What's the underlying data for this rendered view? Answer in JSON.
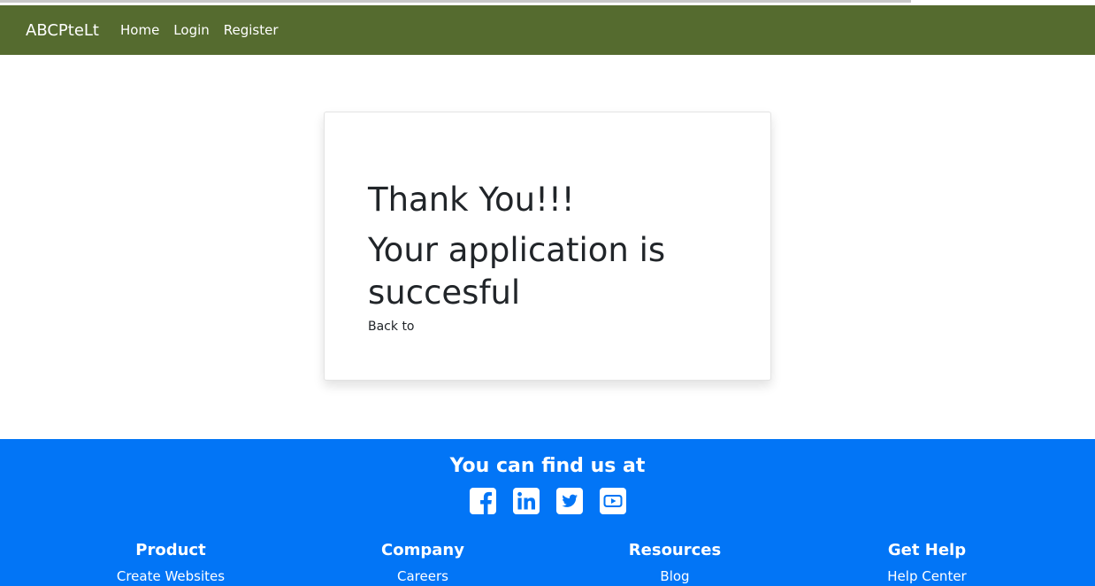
{
  "nav": {
    "brand": "ABCPteLt",
    "links": [
      "Home",
      "Login",
      "Register"
    ]
  },
  "card": {
    "title": "Thank You!!!",
    "message": "Your application is succesful",
    "back_text": "Back to"
  },
  "footer": {
    "heading": "You can find us at",
    "social_icons": [
      "facebook-icon",
      "linkedin-icon",
      "twitter-icon",
      "youtube-icon"
    ],
    "columns": [
      {
        "title": "Product",
        "link": "Create Websites"
      },
      {
        "title": "Company",
        "link": "Careers"
      },
      {
        "title": "Resources",
        "link": "Blog"
      },
      {
        "title": "Get Help",
        "link": "Help Center"
      }
    ]
  },
  "colors": {
    "navbar": "#556b2f",
    "footer": "#0275f6"
  }
}
